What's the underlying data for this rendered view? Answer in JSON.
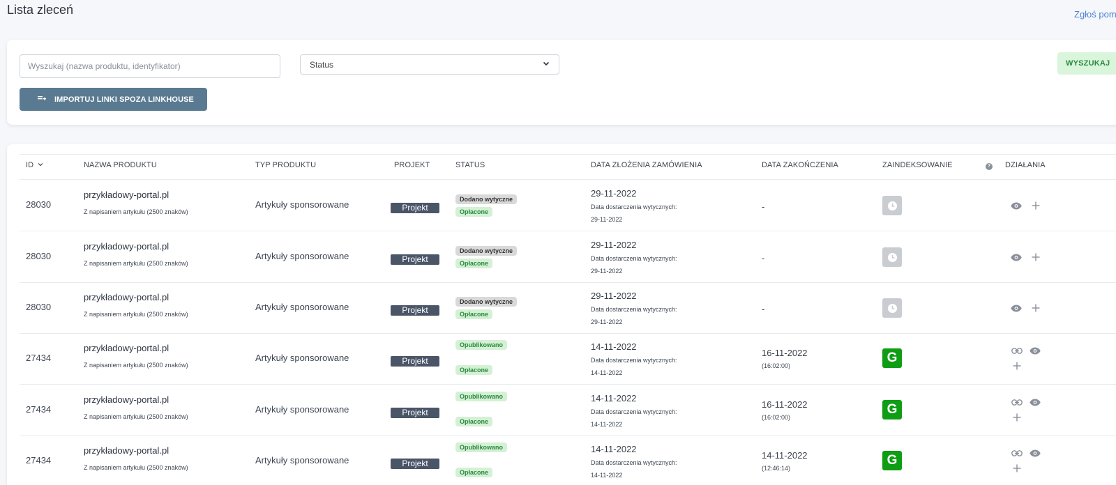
{
  "page": {
    "title": "Lista zleceń",
    "report_link": "Zgłoś pom"
  },
  "filters": {
    "search_placeholder": "Wyszukaj (nazwa produktu, identyfikator)",
    "status_label": "Status",
    "search_button": "WYSZUKAJ",
    "import_button": "IMPORTUJ LINKI SPOZA LINKHOUSE"
  },
  "table": {
    "headers": {
      "id": "ID",
      "product_name": "NAZWA PRODUKTU",
      "product_type": "TYP PRODUKTU",
      "project": "PROJEKT",
      "status": "STATUS",
      "order_date": "DATA ZŁOŻENIA ZAMÓWIENIA",
      "end_date": "DATA ZAKOŃCZENIA",
      "indexing": "ZAINDEKSOWANIE",
      "actions": "DZIAŁANIA"
    },
    "rows": [
      {
        "id": "28030",
        "name": "przykładowy-portal.pl",
        "desc": "Z napisaniem artykułu (2500 znaków)",
        "type": "Artykuły sponsorowane",
        "project": "Projekt",
        "status1": "Dodano wytyczne",
        "status2": "Opłacone",
        "order_date": "29-11-2022",
        "delivery_label": "Data dostarczenia wytycznych:",
        "delivery_date": "29-11-2022",
        "end_date": "-",
        "end_time": "",
        "indexed": "pending"
      },
      {
        "id": "28030",
        "name": "przykładowy-portal.pl",
        "desc": "Z napisaniem artykułu (2500 znaków)",
        "type": "Artykuły sponsorowane",
        "project": "Projekt",
        "status1": "Dodano wytyczne",
        "status2": "Opłacone",
        "order_date": "29-11-2022",
        "delivery_label": "Data dostarczenia wytycznych:",
        "delivery_date": "29-11-2022",
        "end_date": "-",
        "end_time": "",
        "indexed": "pending"
      },
      {
        "id": "28030",
        "name": "przykładowy-portal.pl",
        "desc": "Z napisaniem artykułu (2500 znaków)",
        "type": "Artykuły sponsorowane",
        "project": "Projekt",
        "status1": "Dodano wytyczne",
        "status2": "Opłacone",
        "order_date": "29-11-2022",
        "delivery_label": "Data dostarczenia wytycznych:",
        "delivery_date": "29-11-2022",
        "end_date": "-",
        "end_time": "",
        "indexed": "pending"
      },
      {
        "id": "27434",
        "name": "przykładowy-portal.pl",
        "desc": "Z napisaniem artykułu (2500 znaków)",
        "type": "Artykuły sponsorowane",
        "project": "Projekt",
        "status1": "Opublikowano",
        "status2": "Opłacone",
        "order_date": "14-11-2022",
        "delivery_label": "Data dostarczenia wytycznych:",
        "delivery_date": "14-11-2022",
        "end_date": "16-11-2022",
        "end_time": "(16:02:00)",
        "indexed": "google"
      },
      {
        "id": "27434",
        "name": "przykładowy-portal.pl",
        "desc": "Z napisaniem artykułu (2500 znaków)",
        "type": "Artykuły sponsorowane",
        "project": "Projekt",
        "status1": "Opublikowano",
        "status2": "Opłacone",
        "order_date": "14-11-2022",
        "delivery_label": "Data dostarczenia wytycznych:",
        "delivery_date": "14-11-2022",
        "end_date": "16-11-2022",
        "end_time": "(16:02:00)",
        "indexed": "google"
      },
      {
        "id": "27434",
        "name": "przykładowy-portal.pl",
        "desc": "Z napisaniem artykułu (2500 znaków)",
        "type": "Artykuły sponsorowane",
        "project": "Projekt",
        "status1": "Opublikowano",
        "status2": "Opłacone",
        "order_date": "14-11-2022",
        "delivery_label": "Data dostarczenia wytycznych:",
        "delivery_date": "14-11-2022",
        "end_date": "14-11-2022",
        "end_time": "(12:46:14)",
        "indexed": "google"
      }
    ],
    "google_letter": "G",
    "help_glyph": "?"
  },
  "icons": {
    "sort": "chevron-down-icon",
    "view": "eye-icon",
    "add": "plus-icon",
    "link": "link-icon",
    "clock": "clock-icon",
    "import": "import-icon"
  },
  "colors": {
    "accent_green": "#2b8a3e",
    "import_button": "#5a7a92",
    "google_green": "#0f9d14",
    "link_blue": "#4a7fd6"
  }
}
